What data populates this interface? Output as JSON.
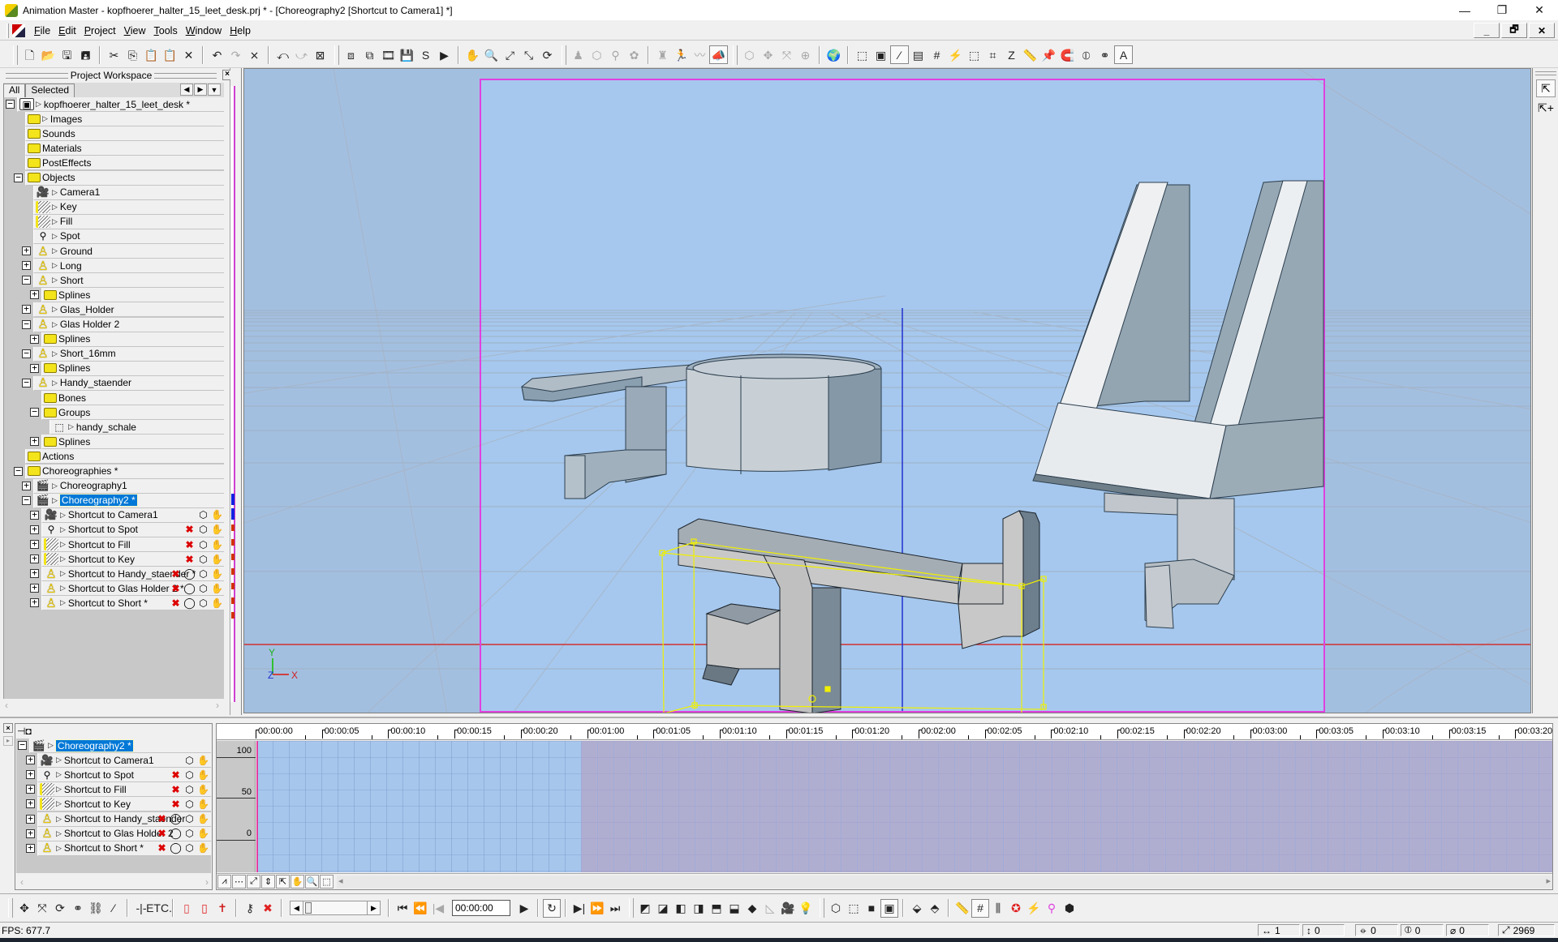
{
  "window": {
    "title": "Animation Master - kopfhoerer_halter_15_leet_desk.prj * - [Choreography2 [Shortcut to Camera1] *]",
    "controls": [
      "minimize-icon",
      "restore-icon",
      "close-icon"
    ],
    "mdi_controls": [
      "_",
      "🗗",
      "✕"
    ]
  },
  "menu": {
    "items": [
      {
        "label": "File"
      },
      {
        "label": "Edit"
      },
      {
        "label": "Project"
      },
      {
        "label": "View"
      },
      {
        "label": "Tools"
      },
      {
        "label": "Window"
      },
      {
        "label": "Help"
      }
    ]
  },
  "toolbar": {
    "groups": [
      [
        {
          "name": "new-icon",
          "glyph": "🗋"
        },
        {
          "name": "open-icon",
          "glyph": "📂"
        },
        {
          "name": "save-icon",
          "glyph": "🖫"
        },
        {
          "name": "save-all-icon",
          "glyph": "🖪"
        }
      ],
      [
        {
          "name": "cut-icon",
          "glyph": "✂"
        },
        {
          "name": "copy-icon",
          "glyph": "⎘"
        },
        {
          "name": "paste-icon",
          "glyph": "📋",
          "dim": true
        },
        {
          "name": "paste-special-icon",
          "glyph": "📋",
          "dim": true
        },
        {
          "name": "delete-icon",
          "glyph": "✕"
        }
      ],
      [
        {
          "name": "undo-icon",
          "glyph": "↶"
        },
        {
          "name": "redo-icon",
          "glyph": "↷",
          "dim": true
        },
        {
          "name": "clear-undo-icon",
          "glyph": "⨯"
        }
      ],
      [
        {
          "name": "undo-view-icon",
          "glyph": "⤺"
        },
        {
          "name": "redo-view-icon",
          "glyph": "⤻",
          "dim": true
        },
        {
          "name": "clear-view-undo-icon",
          "glyph": "⊠"
        }
      ],
      [
        {
          "name": "render-to-file-icon",
          "glyph": "⧈"
        },
        {
          "name": "render-lock-icon",
          "glyph": "⧉"
        },
        {
          "name": "render-video-icon",
          "glyph": "🎞"
        },
        {
          "name": "render-save-icon",
          "glyph": "💾"
        },
        {
          "name": "render-sequence-icon",
          "glyph": "S"
        },
        {
          "name": "play-render-icon",
          "glyph": "▶"
        }
      ],
      [
        {
          "name": "pan-hand-icon",
          "glyph": "✋"
        },
        {
          "name": "zoom-icon",
          "glyph": "🔍"
        },
        {
          "name": "zoom-fit-icon",
          "glyph": "⤢"
        },
        {
          "name": "zoom-selected-icon",
          "glyph": "⤡"
        },
        {
          "name": "turn-icon",
          "glyph": "⟳"
        }
      ],
      [
        {
          "name": "skeletal-mode-icon",
          "glyph": "♟",
          "dim": true
        },
        {
          "name": "muscle-mode-icon",
          "glyph": "⬡",
          "dim": true
        },
        {
          "name": "bone-mode-icon",
          "glyph": "⚲",
          "dim": true
        },
        {
          "name": "smartskin-icon",
          "glyph": "✿",
          "dim": true
        }
      ],
      [
        {
          "name": "animation-mode-icon",
          "glyph": "♜",
          "dim": true
        },
        {
          "name": "action-mode-icon",
          "glyph": "🏃",
          "dim": true
        },
        {
          "name": "spring-mode-icon",
          "glyph": "〰",
          "dim": true
        },
        {
          "name": "choreography-mode-icon",
          "glyph": "📣",
          "pressed": true
        }
      ],
      [
        {
          "name": "translate-mode-icon",
          "glyph": "⬡",
          "dim": true
        },
        {
          "name": "move-mode-icon",
          "glyph": "✥",
          "dim": true
        },
        {
          "name": "scale-mode-icon",
          "glyph": "⤧",
          "dim": true
        },
        {
          "name": "rotate-mode-icon",
          "glyph": "⊕",
          "dim": true
        }
      ],
      [
        {
          "name": "globe-icon",
          "glyph": "🌍"
        }
      ],
      [
        {
          "name": "group-icon",
          "glyph": "⬚"
        },
        {
          "name": "hide-icon",
          "glyph": "▣"
        },
        {
          "name": "spline-icon",
          "glyph": "⁄",
          "pressed": true
        },
        {
          "name": "properties-icon",
          "glyph": "▤"
        },
        {
          "name": "grid-snap-icon",
          "glyph": "#"
        },
        {
          "name": "lathe-icon",
          "glyph": "⚡"
        },
        {
          "name": "select-icon",
          "glyph": "⬚"
        },
        {
          "name": "grid-icon",
          "glyph": "⌗"
        },
        {
          "name": "z-icon",
          "glyph": "Z"
        },
        {
          "name": "ruler-icon",
          "glyph": "📏"
        },
        {
          "name": "pin-icon",
          "glyph": "📌"
        },
        {
          "name": "magnet-icon",
          "glyph": "🧲"
        },
        {
          "name": "compass-icon",
          "glyph": "⦶"
        },
        {
          "name": "link-icon",
          "glyph": "⚭"
        },
        {
          "name": "text-icon",
          "glyph": "A",
          "pressed": true
        }
      ]
    ]
  },
  "workspace": {
    "title": "Project Workspace",
    "tabs": [
      {
        "label": "All",
        "active": true
      },
      {
        "label": "Selected",
        "active": false
      }
    ],
    "tree": [
      {
        "label": "kopfhoerer_halter_15_leet_desk *",
        "depth": 0,
        "expander": "minus",
        "icon": "proj",
        "arrow": true
      },
      {
        "label": "Images",
        "depth": 1,
        "icon": "folder",
        "arrow": true
      },
      {
        "label": "Sounds",
        "depth": 1,
        "icon": "folder"
      },
      {
        "label": "Materials",
        "depth": 1,
        "icon": "folder"
      },
      {
        "label": "PostEffects",
        "depth": 1,
        "icon": "folder"
      },
      {
        "label": "Objects",
        "depth": 1,
        "expander": "minus",
        "icon": "folder"
      },
      {
        "label": "Camera1",
        "depth": 2,
        "icon": "camera",
        "arrow": true
      },
      {
        "label": "Key",
        "depth": 2,
        "icon": "light",
        "arrow": true
      },
      {
        "label": "Fill",
        "depth": 2,
        "icon": "light",
        "arrow": true
      },
      {
        "label": "Spot",
        "depth": 2,
        "icon": "spot",
        "arrow": true
      },
      {
        "label": "Ground",
        "depth": 2,
        "expander": "plus",
        "icon": "model",
        "arrow": true
      },
      {
        "label": "Long",
        "depth": 2,
        "expander": "plus",
        "icon": "model",
        "arrow": true
      },
      {
        "label": "Short",
        "depth": 2,
        "expander": "minus",
        "icon": "model",
        "arrow": true
      },
      {
        "label": "Splines",
        "depth": 3,
        "expander": "plus",
        "icon": "folder"
      },
      {
        "label": "Glas_Holder",
        "depth": 2,
        "expander": "plus",
        "icon": "model",
        "arrow": true
      },
      {
        "label": "Glas Holder 2",
        "depth": 2,
        "expander": "minus",
        "icon": "model",
        "arrow": true
      },
      {
        "label": "Splines",
        "depth": 3,
        "expander": "plus",
        "icon": "folder"
      },
      {
        "label": "Short_16mm",
        "depth": 2,
        "expander": "minus",
        "icon": "model",
        "arrow": true
      },
      {
        "label": "Splines",
        "depth": 3,
        "expander": "plus",
        "icon": "folder"
      },
      {
        "label": "Handy_staender",
        "depth": 2,
        "expander": "minus",
        "icon": "model",
        "arrow": true
      },
      {
        "label": "Bones",
        "depth": 3,
        "icon": "folder"
      },
      {
        "label": "Groups",
        "depth": 3,
        "expander": "minus",
        "icon": "folder"
      },
      {
        "label": "handy_schale",
        "depth": 4,
        "icon": "group",
        "arrow": true
      },
      {
        "label": "Splines",
        "depth": 3,
        "expander": "plus",
        "icon": "folder"
      },
      {
        "label": "Actions",
        "depth": 1,
        "icon": "folder"
      },
      {
        "label": "Choreographies *",
        "depth": 1,
        "expander": "minus",
        "icon": "folder"
      },
      {
        "label": "Choreography1",
        "depth": 2,
        "expander": "plus",
        "icon": "chor",
        "arrow": true
      },
      {
        "label": "Choreography2 *",
        "depth": 2,
        "expander": "minus",
        "icon": "chor",
        "arrow": true,
        "selected": true
      },
      {
        "label": "Shortcut to Camera1",
        "depth": 3,
        "expander": "plus",
        "icon": "camera",
        "arrow": true,
        "props": [
          "cage",
          "hand"
        ]
      },
      {
        "label": "Shortcut to Spot",
        "depth": 3,
        "expander": "plus",
        "icon": "spot",
        "arrow": true,
        "props": [
          "noact",
          "cage",
          "hand"
        ]
      },
      {
        "label": "Shortcut to Fill",
        "depth": 3,
        "expander": "plus",
        "icon": "light",
        "arrow": true,
        "props": [
          "noact",
          "cage",
          "hand"
        ]
      },
      {
        "label": "Shortcut to Key",
        "depth": 3,
        "expander": "plus",
        "icon": "light",
        "arrow": true,
        "props": [
          "noact",
          "cage",
          "hand"
        ]
      },
      {
        "label": "Shortcut to Handy_staender *",
        "depth": 3,
        "expander": "plus",
        "icon": "model",
        "arrow": true,
        "props": [
          "noact",
          "ring",
          "cage",
          "hand"
        ]
      },
      {
        "label": "Shortcut to Glas Holder 2 *",
        "depth": 3,
        "expander": "plus",
        "icon": "model",
        "arrow": true,
        "props": [
          "noact",
          "ring",
          "cage",
          "hand"
        ]
      },
      {
        "label": "Shortcut to Short *",
        "depth": 3,
        "expander": "plus",
        "icon": "model",
        "arrow": true,
        "props": [
          "noact",
          "ring",
          "cage",
          "hand"
        ]
      }
    ]
  },
  "viewport": {
    "axis_labels": {
      "x": "X",
      "y": "Y",
      "z": "Z"
    },
    "tools": [
      {
        "name": "select-arrow-icon",
        "glyph": "⇱",
        "active": true
      },
      {
        "name": "add-select-arrow-icon",
        "glyph": "⇱+"
      }
    ],
    "colors": {
      "background": "#a3bfe0",
      "camera_frame": "#e040e0",
      "selection": "#f0f000",
      "x_axis": "#d03030",
      "y_axis": "#2030d0"
    }
  },
  "timeline": {
    "tree": [
      {
        "label": "Choreography2 *",
        "depth": 0,
        "expander": "minus",
        "icon": "chor",
        "arrow": true,
        "selected": true
      },
      {
        "label": "Shortcut to Camera1",
        "depth": 1,
        "expander": "plus",
        "icon": "camera",
        "arrow": true,
        "props": [
          "cage",
          "hand"
        ]
      },
      {
        "label": "Shortcut to Spot",
        "depth": 1,
        "expander": "plus",
        "icon": "spot",
        "arrow": true,
        "props": [
          "noact",
          "cage",
          "hand"
        ]
      },
      {
        "label": "Shortcut to Fill",
        "depth": 1,
        "expander": "plus",
        "icon": "light",
        "arrow": true,
        "props": [
          "noact",
          "cage",
          "hand"
        ]
      },
      {
        "label": "Shortcut to Key",
        "depth": 1,
        "expander": "plus",
        "icon": "light",
        "arrow": true,
        "props": [
          "noact",
          "cage",
          "hand"
        ]
      },
      {
        "label": "Shortcut to Handy_staender",
        "depth": 1,
        "expander": "plus",
        "icon": "model",
        "arrow": true,
        "props": [
          "noact",
          "ring",
          "cage",
          "hand"
        ]
      },
      {
        "label": "Shortcut to Glas Holder 2",
        "depth": 1,
        "expander": "plus",
        "icon": "model",
        "arrow": true,
        "props": [
          "noact",
          "ring",
          "cage",
          "hand"
        ]
      },
      {
        "label": "Shortcut to Short *",
        "depth": 1,
        "expander": "plus",
        "icon": "model",
        "arrow": true,
        "props": [
          "noact",
          "ring",
          "cage",
          "hand"
        ]
      }
    ],
    "ruler_labels": [
      "00:00:00",
      "00:00:05",
      "00:00:10",
      "00:00:15",
      "00:00:20",
      "00:01:00",
      "00:01:05",
      "00:01:10",
      "00:01:15",
      "00:01:20",
      "00:02:00",
      "00:02:05",
      "00:02:10",
      "00:02:15",
      "00:02:20",
      "00:03:00",
      "00:03:05",
      "00:03:10",
      "00:03:15",
      "00:03:20"
    ],
    "y_labels": [
      "100",
      "50",
      "0"
    ],
    "range_end_label": "00:01:00",
    "graph_tools": [
      {
        "name": "channel-graph-icon",
        "glyph": "⩘"
      },
      {
        "name": "dopesheet-icon",
        "glyph": "⋯"
      },
      {
        "name": "fit-icon",
        "glyph": "⤢"
      },
      {
        "name": "fit-vertical-icon",
        "glyph": "⇕"
      },
      {
        "name": "select-arrow-icon",
        "glyph": "⇱"
      },
      {
        "name": "pan-hand-icon",
        "glyph": "✋"
      },
      {
        "name": "zoom-icon",
        "glyph": "🔍"
      },
      {
        "name": "box-select-icon",
        "glyph": "⬚"
      }
    ]
  },
  "bottom_toolbar": {
    "left": [
      {
        "name": "translate-icon",
        "glyph": "✥"
      },
      {
        "name": "scale-icon",
        "glyph": "⤧"
      },
      {
        "name": "rotate-icon",
        "glyph": "⟳"
      },
      {
        "name": "group-properties-icon",
        "glyph": "⚭"
      },
      {
        "name": "stretch-icon",
        "glyph": "⛓"
      },
      {
        "name": "path-icon",
        "glyph": "⁄"
      },
      {
        "name": "bias-icon",
        "glyph": "-|-"
      },
      {
        "name": "etc-icon",
        "glyph": "ETC."
      },
      {
        "name": "manipulator-icon",
        "glyph": "▯",
        "color": "#e04040"
      },
      {
        "name": "manipulator-2-icon",
        "glyph": "▯",
        "color": "#e02020"
      },
      {
        "name": "skeleton-icon",
        "glyph": "✝",
        "color": "#d02020"
      },
      {
        "name": "key-icon",
        "glyph": "⚷"
      },
      {
        "name": "delete-key-icon",
        "glyph": "✖",
        "color": "#e02020"
      }
    ],
    "transport": [
      {
        "name": "first-frame-icon",
        "glyph": "⏮"
      },
      {
        "name": "prev-key-icon",
        "glyph": "⏪",
        "dim": true
      },
      {
        "name": "prev-frame-icon",
        "glyph": "|◀",
        "dim": true
      }
    ],
    "time_value": "00:00:00",
    "transport_right": [
      {
        "name": "play-icon",
        "glyph": "▶"
      },
      {
        "name": "loop-icon",
        "glyph": "↻",
        "pressed": true
      },
      {
        "name": "next-frame-icon",
        "glyph": "▶|"
      },
      {
        "name": "next-key-icon",
        "glyph": "⏩"
      },
      {
        "name": "last-frame-icon",
        "glyph": "⏭"
      }
    ],
    "views": [
      {
        "name": "view-front-icon",
        "glyph": "◩"
      },
      {
        "name": "view-back-icon",
        "glyph": "◪"
      },
      {
        "name": "view-left-icon",
        "glyph": "◧"
      },
      {
        "name": "view-right-icon",
        "glyph": "◨"
      },
      {
        "name": "view-top-icon",
        "glyph": "⬒"
      },
      {
        "name": "view-bottom-icon",
        "glyph": "⬓"
      },
      {
        "name": "view-bird-icon",
        "glyph": "◆"
      },
      {
        "name": "view-light-icon",
        "glyph": "◺",
        "dim": true
      },
      {
        "name": "view-camera-icon",
        "glyph": "🎥"
      },
      {
        "name": "view-lamp-icon",
        "glyph": "💡"
      }
    ],
    "render": [
      {
        "name": "bound-box-icon",
        "glyph": "⬡"
      },
      {
        "name": "wireframe-icon",
        "glyph": "⬚"
      },
      {
        "name": "shaded-icon",
        "glyph": "■"
      },
      {
        "name": "shaded-wire-icon",
        "glyph": "▣",
        "pressed": true
      },
      {
        "name": "quick-render-icon",
        "glyph": "⬙"
      },
      {
        "name": "render-mode-icon",
        "glyph": "⬘"
      },
      {
        "name": "ruler-icon",
        "glyph": "📏"
      },
      {
        "name": "grid-icon",
        "glyph": "#",
        "pressed": true
      },
      {
        "name": "tracks-icon",
        "glyph": "⫼"
      },
      {
        "name": "star-icon",
        "glyph": "✪",
        "color": "#e02020"
      },
      {
        "name": "projector-icon",
        "glyph": "⚡"
      },
      {
        "name": "bones-icon",
        "glyph": "⚲",
        "color": "#e040e0"
      },
      {
        "name": "cage-icon",
        "glyph": "⬢"
      }
    ]
  },
  "status": {
    "fps": "FPS: 677.7",
    "fields": [
      {
        "name": "translate-x-readout",
        "glyph": "↔",
        "value": "1"
      },
      {
        "name": "translate-y-readout",
        "glyph": "↕",
        "value": "0"
      },
      {
        "name": "rotate-x-readout",
        "glyph": "⦵",
        "value": "0"
      },
      {
        "name": "rotate-y-readout",
        "glyph": "⦶",
        "value": "0"
      },
      {
        "name": "rotate-z-readout",
        "glyph": "⌀",
        "value": "0"
      },
      {
        "name": "scale-readout",
        "glyph": "⤢",
        "value": "2969"
      }
    ]
  }
}
